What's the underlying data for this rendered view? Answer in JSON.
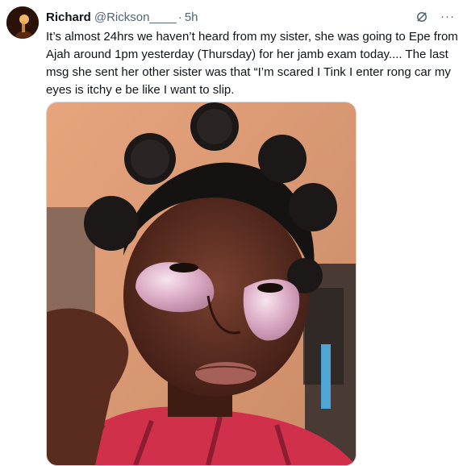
{
  "tweet": {
    "author_name": "Richard",
    "handle": "@Rickson____",
    "separator": "·",
    "time": "5h",
    "text": "It’s almost 24hrs we haven’t heard from my sister, she was going to Epe from Ajah around 1pm yesterday (Thursday) for her jamb exam today.... The last msg she sent her other sister  was that “I’m scared I Tink I enter rong car my eyes is itchy e be like I want to slip.",
    "icons": {
      "grok": "grok-icon",
      "more": "more-options-icon"
    },
    "more_glyph": "···",
    "media_alt": "Photo of a girl with hair in bantu knots wearing under-eye patches"
  },
  "colors": {
    "text": "#0f1419",
    "secondary": "#536471",
    "border": "#cfd9de"
  }
}
